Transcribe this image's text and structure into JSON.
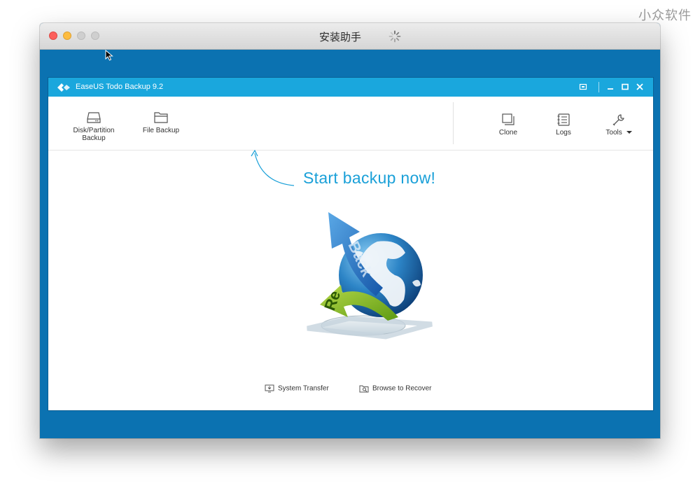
{
  "watermark": "小众软件",
  "mac_window": {
    "title": "安装助手"
  },
  "app": {
    "title": "EaseUS Todo Backup 9.2",
    "toolbar": {
      "disk_partition_backup": [
        "Disk/Partition",
        "Backup"
      ],
      "file_backup": "File Backup",
      "clone": "Clone",
      "logs": "Logs",
      "tools": "Tools"
    },
    "hero_text": "Start backup now!",
    "hero_image_text": [
      "Back",
      "Re"
    ],
    "links": {
      "system_transfer": "System Transfer",
      "browse_to_recover": "Browse to Recover"
    }
  },
  "colors": {
    "mac_background": "#0b72b1",
    "app_titlebar": "#1aa7dd",
    "accent_text": "#1aa0d8"
  }
}
